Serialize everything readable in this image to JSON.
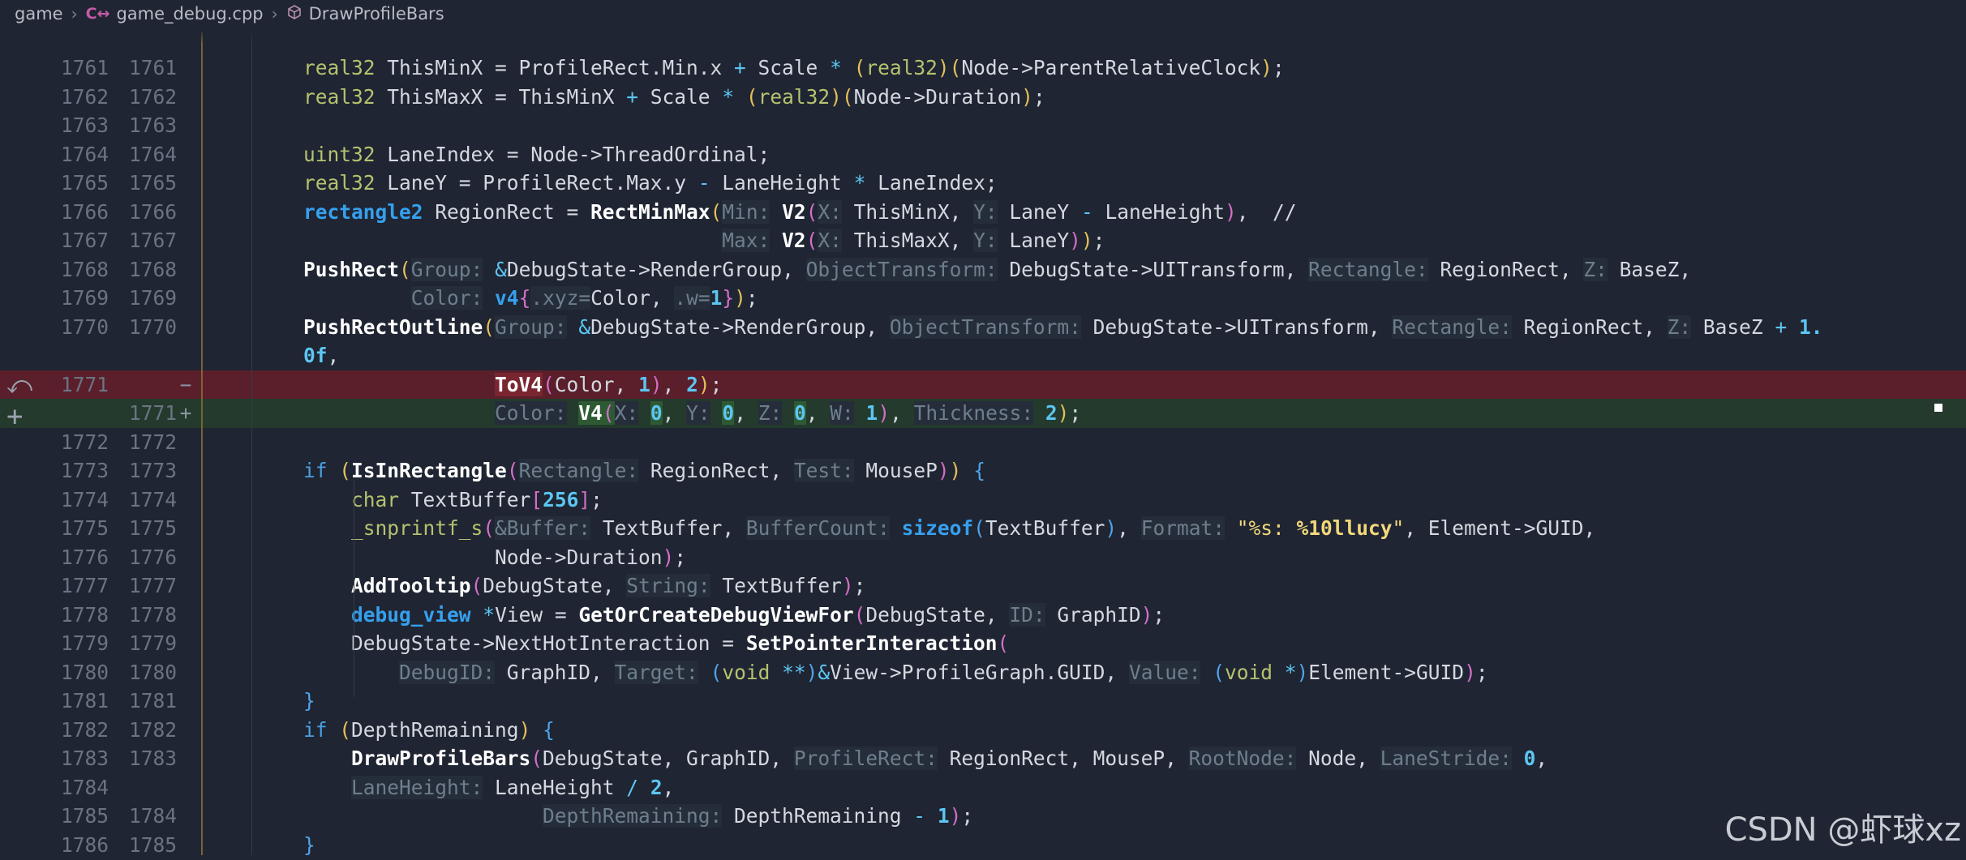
{
  "breadcrumb": {
    "items": [
      "game",
      "game_debug.cpp",
      "DrawProfileBars"
    ]
  },
  "gutter_icons": {
    "revert": "revert-icon",
    "add": "add-line-icon"
  },
  "watermark": "CSDN @虾球xz",
  "lines": [
    {
      "a": "1761",
      "b": "1761",
      "mk": "",
      "html": "<span class='ty'>real32</span> ThisMinX = ProfileRect.Min.x <span class='op'>+</span> Scale <span class='op'>*</span> <span class='pa'>(</span><span class='ty'>real32</span><span class='pa'>)</span><span class='pa'>(</span>Node-&gt;ParentRelativeClock<span class='pa'>)</span>;",
      "type": "norm"
    },
    {
      "a": "1762",
      "b": "1762",
      "mk": "",
      "html": "<span class='ty'>real32</span> ThisMaxX = ThisMinX <span class='op'>+</span> Scale <span class='op'>*</span> <span class='pa'>(</span><span class='ty'>real32</span><span class='pa'>)</span><span class='pa'>(</span>Node-&gt;Duration<span class='pa'>)</span>;",
      "type": "norm"
    },
    {
      "a": "1763",
      "b": "1763",
      "mk": "",
      "html": "",
      "type": "norm"
    },
    {
      "a": "1764",
      "b": "1764",
      "mk": "",
      "html": "<span class='ty'>uint32</span> LaneIndex = Node-&gt;ThreadOrdinal;",
      "type": "norm"
    },
    {
      "a": "1765",
      "b": "1765",
      "mk": "",
      "html": "<span class='ty'>real32</span> LaneY = ProfileRect.Max.y <span class='op'>-</span> LaneHeight <span class='op'>*</span> LaneIndex;",
      "type": "norm"
    },
    {
      "a": "1766",
      "b": "1766",
      "mk": "",
      "html": "<span class='kw'>rectangle2</span> RegionRect = <span class='fn'>RectMinMax</span><span class='pa'>(</span><span class='hint'>Min:</span> <span class='fn'>V2</span><span class='pb'>(</span><span class='hint'>X:</span> ThisMinX, <span class='hint'>Y:</span> LaneY <span class='op'>-</span> LaneHeight<span class='pb'>)</span>,  //",
      "type": "norm"
    },
    {
      "a": "1767",
      "b": "1767",
      "mk": "",
      "html": "                                   <span class='hint'>Max:</span> <span class='fn'>V2</span><span class='pb'>(</span><span class='hint'>X:</span> ThisMaxX, <span class='hint'>Y:</span> LaneY<span class='pb'>)</span><span class='pa'>)</span>;",
      "type": "norm"
    },
    {
      "a": "1768",
      "b": "1768",
      "mk": "",
      "html": "<span class='fn'>PushRect</span><span class='pa'>(</span><span class='hint'>Group:</span> <span class='op'>&amp;</span>DebugState-&gt;RenderGroup, <span class='hint'>ObjectTransform:</span> DebugState-&gt;UITransform, <span class='hint'>Rectangle:</span> RegionRect, <span class='hint'>Z:</span> BaseZ,",
      "type": "norm"
    },
    {
      "a": "1769",
      "b": "1769",
      "mk": "",
      "html": "         <span class='hint'>Color:</span> <span class='kw'>v4</span><span class='pb'>{</span><span class='hint'>.xyz=</span>Color, <span class='hint'>.w=</span><span class='num'>1</span><span class='pb'>}</span><span class='pa'>)</span>;",
      "type": "norm"
    },
    {
      "a": "1770",
      "b": "1770",
      "mk": "",
      "html": "<span class='fn'>PushRectOutline</span><span class='pa'>(</span><span class='hint'>Group:</span> <span class='op'>&amp;</span>DebugState-&gt;RenderGroup, <span class='hint'>ObjectTransform:</span> DebugState-&gt;UITransform, <span class='hint'>Rectangle:</span> RegionRect, <span class='hint'>Z:</span> BaseZ <span class='op'>+</span> <span class='num'>1.</span>",
      "type": "norm"
    },
    {
      "a": "",
      "b": "",
      "mk": "",
      "html": "<span class='num'>0f</span>,",
      "type": "norm"
    },
    {
      "a": "1771",
      "b": "",
      "mk": "−",
      "html": "                <span class='fn del-tok'>ToV4</span><span class='pb'>(</span>Color, <span class='num'>1</span><span class='pb'>)</span>, <span class='num'>2</span><span class='pa'>)</span>;",
      "type": "del"
    },
    {
      "a": "",
      "b": "1771",
      "mk": "+",
      "html": "                <span class='hint'>Color:</span> <span class='fn add-tok'>V4</span><span class='pb add-tok'>(</span><span class='hint'>X:</span> <span class='num add-tok'>0</span>, <span class='hint'>Y:</span> <span class='num add-tok'>0</span>, <span class='hint'>Z:</span> <span class='num add-tok'>0</span>, <span class='hint'>W:</span> <span class='num'>1</span><span class='pb'>)</span>, <span class='hint'>Thickness:</span> <span class='num'>2</span><span class='pa'>)</span>;",
      "type": "add"
    },
    {
      "a": "1772",
      "b": "1772",
      "mk": "",
      "html": "",
      "type": "norm"
    },
    {
      "a": "1773",
      "b": "1773",
      "mk": "",
      "html": "<span class='kw2'>if</span> <span class='pa'>(</span><span class='fn'>IsInRectangle</span><span class='pb'>(</span><span class='hint'>Rectangle:</span> RegionRect, <span class='hint'>Test:</span> MouseP<span class='pb'>)</span><span class='pa'>)</span> <span class='pc'>{</span>",
      "type": "norm"
    },
    {
      "a": "1774",
      "b": "1774",
      "mk": "",
      "html": "    <span class='ty'>char</span> TextBuffer<span class='pb'>[</span><span class='num'>256</span><span class='pb'>]</span>;",
      "type": "norm"
    },
    {
      "a": "1775",
      "b": "1775",
      "mk": "",
      "html": "    <span class='ty'>_snprintf_s</span><span class='pb'>(</span><span class='hint'>&amp;Buffer:</span> TextBuffer, <span class='hint'>BufferCount:</span> <span class='kw'>sizeof</span><span class='pc'>(</span>TextBuffer<span class='pc'>)</span>, <span class='hint'>Format:</span> <span class='str'>\"%s: <b>%10llucy</b>\"</span>, Element-&gt;GUID,",
      "type": "norm"
    },
    {
      "a": "1776",
      "b": "1776",
      "mk": "",
      "html": "                Node-&gt;Duration<span class='pb'>)</span>;",
      "type": "norm"
    },
    {
      "a": "1777",
      "b": "1777",
      "mk": "",
      "html": "    <span class='fn'>AddTooltip</span><span class='pb'>(</span>DebugState, <span class='hint'>String:</span> TextBuffer<span class='pb'>)</span>;",
      "type": "norm"
    },
    {
      "a": "1778",
      "b": "1778",
      "mk": "",
      "html": "    <span class='kw'>debug_view</span> <span class='op'>*</span>View = <span class='fn'>GetOrCreateDebugViewFor</span><span class='pb'>(</span>DebugState, <span class='hint'>ID:</span> GraphID<span class='pb'>)</span>;",
      "type": "norm"
    },
    {
      "a": "1779",
      "b": "1779",
      "mk": "",
      "html": "    DebugState-&gt;NextHotInteraction = <span class='fn'>SetPointerInteraction</span><span class='pb'>(</span>",
      "type": "norm"
    },
    {
      "a": "1780",
      "b": "1780",
      "mk": "",
      "html": "        <span class='hint'>DebugID:</span> GraphID, <span class='hint'>Target:</span> <span class='pc'>(</span><span class='ty'>void</span> <span class='op'>**</span><span class='pc'>)</span><span class='op'>&amp;</span>View-&gt;ProfileGraph.GUID, <span class='hint'>Value:</span> <span class='pc'>(</span><span class='ty'>void</span> <span class='op'>*</span><span class='pc'>)</span>Element-&gt;GUID<span class='pb'>)</span>;",
      "type": "norm"
    },
    {
      "a": "1781",
      "b": "1781",
      "mk": "",
      "html": "<span class='pc'>}</span>",
      "type": "norm"
    },
    {
      "a": "1782",
      "b": "1782",
      "mk": "",
      "html": "<span class='kw2'>if</span> <span class='pa'>(</span>DepthRemaining<span class='pa'>)</span> <span class='pc'>{</span>",
      "type": "norm"
    },
    {
      "a": "1783",
      "b": "1783",
      "mk": "",
      "html": "    <span class='fn'>DrawProfileBars</span><span class='pb'>(</span>DebugState, GraphID, <span class='hint'>ProfileRect:</span> RegionRect, MouseP, <span class='hint'>RootNode:</span> Node, <span class='hint'>LaneStride:</span> <span class='num'>0</span>,",
      "type": "norm"
    },
    {
      "a": "1784",
      "b": "",
      "mk": "",
      "html": "    <span class='hint'>LaneHeight:</span> LaneHeight <span class='op'>/</span> <span class='num'>2</span>,",
      "type": "norm"
    },
    {
      "a": "1785",
      "b": "1784",
      "mk": "",
      "html": "                    <span class='hint'>DepthRemaining:</span> DepthRemaining <span class='op'>-</span> <span class='num'>1</span><span class='pb'>)</span>;",
      "type": "norm"
    },
    {
      "a": "1786",
      "b": "1785",
      "mk": "",
      "html": "<span class='pc'>}</span>",
      "type": "norm"
    }
  ]
}
